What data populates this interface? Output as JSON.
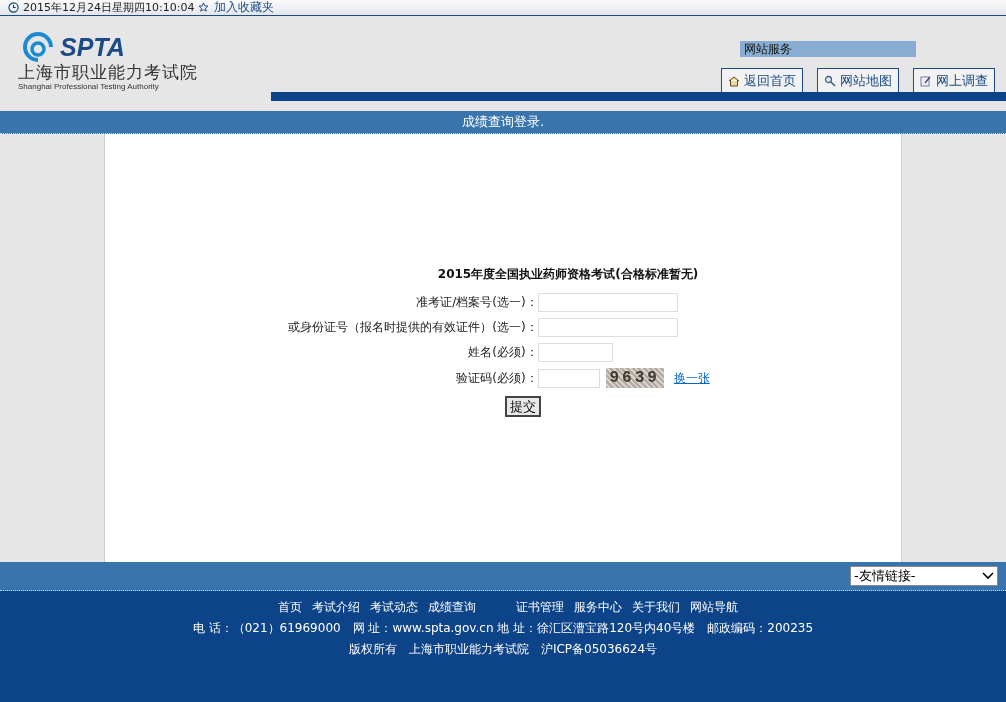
{
  "top_bar": {
    "datetime": "2015年12月24日星期四10:10:04",
    "bookmark_link": "加入收藏夹"
  },
  "header": {
    "logo_text": "SPTA",
    "org_name": "上海市职业能力考试院",
    "org_name_en": "Shanghai Professional Testing Authority",
    "services_title": "网站服务",
    "nav_buttons": [
      {
        "label": "返回首页",
        "kind": "home"
      },
      {
        "label": "网站地图",
        "kind": "search"
      },
      {
        "label": "网上调查",
        "kind": "survey"
      }
    ]
  },
  "banner": {
    "title": "成绩查询登录."
  },
  "form": {
    "title": "2015年度全国执业药师资格考试(合格标准暂无)",
    "fields": [
      {
        "label": "准考证/档案号(选一)：",
        "kind": "long"
      },
      {
        "label": "或身份证号（报名时提供的有效证件）(选一)：",
        "kind": "long"
      },
      {
        "label": "姓名(必须)：",
        "kind": "short"
      },
      {
        "label": "验证码(必须)：",
        "kind": "captcha"
      }
    ],
    "captcha": "9639",
    "refresh_link": "换一张",
    "submit": "提交"
  },
  "footer": {
    "friend_links": "-友情链接-",
    "links": [
      {
        "label": "首页"
      },
      {
        "label": "考试介绍"
      },
      {
        "label": "考试动态"
      },
      {
        "label": "成绩查询"
      },
      {
        "label": "证书管理"
      },
      {
        "label": "服务中心"
      },
      {
        "label": "关于我们"
      },
      {
        "label": "网站导航"
      }
    ],
    "contact": "电 话：（021）61969000　网 址：www.spta.gov.cn 地 址：徐汇区漕宝路120号内40号楼　邮政编码：200235",
    "copyright": "版权所有　上海市职业能力考试院　沪ICP备05036624号"
  }
}
